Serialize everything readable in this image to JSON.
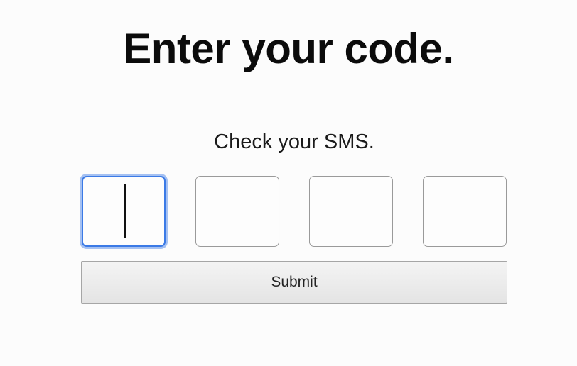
{
  "header": {
    "title": "Enter your code."
  },
  "instructions": {
    "text": "Check your SMS."
  },
  "code_inputs": [
    {
      "value": "",
      "focused": true
    },
    {
      "value": "",
      "focused": false
    },
    {
      "value": "",
      "focused": false
    },
    {
      "value": "",
      "focused": false
    }
  ],
  "actions": {
    "submit_label": "Submit"
  },
  "colors": {
    "focus_ring": "#3b7ae6",
    "input_border": "#9a9a9a",
    "button_border": "#a6a6a6"
  }
}
